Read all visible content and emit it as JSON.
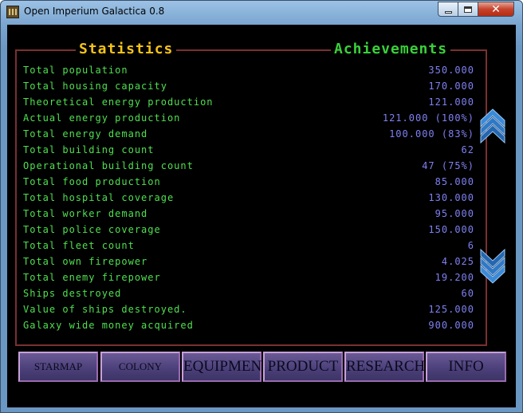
{
  "window": {
    "title": "Open Imperium Galactica 0.8"
  },
  "panels": {
    "statistics_title": "Statistics",
    "achievements_title": "Achievements"
  },
  "stats": [
    {
      "label": "Total population",
      "value": "350.000"
    },
    {
      "label": "Total housing capacity",
      "value": "170.000"
    },
    {
      "label": "Theoretical energy production",
      "value": "121.000"
    },
    {
      "label": "Actual energy production",
      "value": "121.000 (100%)"
    },
    {
      "label": "Total energy demand",
      "value": "100.000 (83%)"
    },
    {
      "label": "Total building count",
      "value": "62"
    },
    {
      "label": "Operational building count",
      "value": "47 (75%)"
    },
    {
      "label": "Total food production",
      "value": "85.000"
    },
    {
      "label": "Total hospital coverage",
      "value": "130.000"
    },
    {
      "label": "Total worker demand",
      "value": "95.000"
    },
    {
      "label": "Total police coverage",
      "value": "150.000"
    },
    {
      "label": "Total fleet count",
      "value": "6"
    },
    {
      "label": "Total own firepower",
      "value": "4.025"
    },
    {
      "label": "Total enemy firepower",
      "value": "19.200"
    },
    {
      "label": "Ships destroyed",
      "value": "60"
    },
    {
      "label": "Value of ships destroyed.",
      "value": "125.000"
    },
    {
      "label": "Galaxy wide money acquired",
      "value": "900.000"
    }
  ],
  "nav": {
    "starmap": "STARMAP",
    "colony": "COLONY",
    "equipment": "EQUIPMENT",
    "product": "PRODUCT",
    "research": "RESEARCH",
    "info": "INFO"
  },
  "icons": {
    "scroll_up": "chevron-up-icon",
    "scroll_down": "chevron-down-icon"
  },
  "colors": {
    "stat_label": "#4fe04f",
    "stat_value": "#7f80f2",
    "statistics_title": "#f4c21a",
    "achievements_title": "#3ad03a",
    "frame": "#7a3030",
    "scroll_button": "#3a8ad8"
  }
}
